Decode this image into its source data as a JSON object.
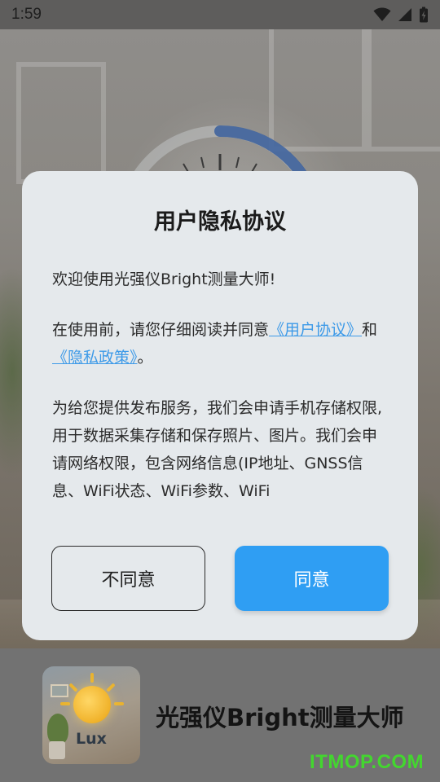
{
  "status_bar": {
    "time": "1:59",
    "icons": [
      "wifi-icon",
      "cell-signal-icon",
      "battery-charging-icon"
    ]
  },
  "dialog": {
    "title": "用户隐私协议",
    "welcome": "欢迎使用光强仪Bright测量大师!",
    "before_use_prefix": "在使用前，请您仔细阅读并同意",
    "user_agreement_link": "《用户协议》",
    "and_text": "和",
    "privacy_policy_link": "《隐私政策》",
    "period": "。",
    "permissions_text": "为给您提供发布服务，我们会申请手机存储权限, 用于数据采集存储和保存照片、图片。我们会申请网络权限，包含网络信息(IP地址、GNSS信息、WiFi状态、WiFi参数、WiFi",
    "disagree_label": "不同意",
    "agree_label": "同意",
    "link_color": "#3d9ae8",
    "agree_color": "#2f9ef3"
  },
  "brand": {
    "app_name": "光强仪Bright测量大师",
    "icon_text": "Lux"
  },
  "watermark": "ITMOP.COM"
}
